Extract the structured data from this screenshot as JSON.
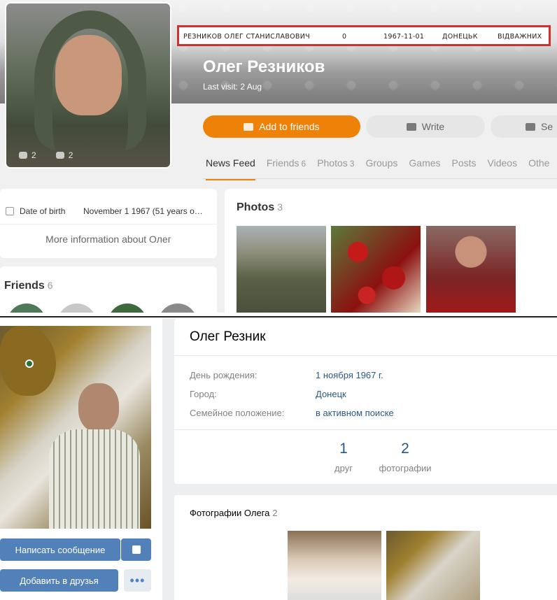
{
  "ok": {
    "avatar_stats": {
      "comments": "2",
      "likes": "2"
    },
    "highlight": {
      "full_name": "РЕЗНИКОВ ОЛЕГ СТАНИСЛАВОВИЧ",
      "number": "0",
      "date": "1967-11-01",
      "city": "ДОНЕЦЬК",
      "note": "ВІДВАЖНИХ"
    },
    "name": "Олег Резников",
    "last_visit": "Last visit: 2 Aug",
    "buttons": {
      "add_friends": "Add to friends",
      "write": "Write",
      "send": "Se"
    },
    "tabs": [
      {
        "label": "News Feed",
        "count": ""
      },
      {
        "label": "Friends",
        "count": "6"
      },
      {
        "label": "Photos",
        "count": "3"
      },
      {
        "label": "Groups",
        "count": ""
      },
      {
        "label": "Games",
        "count": ""
      },
      {
        "label": "Posts",
        "count": ""
      },
      {
        "label": "Videos",
        "count": ""
      },
      {
        "label": "Othe",
        "count": ""
      }
    ],
    "info": {
      "dob_label": "Date of birth",
      "dob_value": "November 1 1967 (51 years o…",
      "more": "More information about Олег"
    },
    "friends": {
      "title": "Friends",
      "count": "6"
    },
    "photos": {
      "title": "Photos",
      "count": "3"
    },
    "colors": {
      "accent": "#ee8208"
    }
  },
  "vk": {
    "buttons": {
      "message": "Написать сообщение",
      "add_friend": "Добавить в друзья",
      "more": "•••"
    },
    "name": "Олег Резник",
    "rows": [
      {
        "label": "День рождения:",
        "value": "1 ноября 1967 г."
      },
      {
        "label": "Город:",
        "value": "Донецк"
      },
      {
        "label": "Семейное положение:",
        "value": "в активном поиске"
      }
    ],
    "counters": [
      {
        "n": "1",
        "label": "друг"
      },
      {
        "n": "2",
        "label": "фотографии"
      }
    ],
    "photos": {
      "title": "Фотографии Олега",
      "count": "2"
    },
    "colors": {
      "accent": "#5181b8",
      "link": "#2a5885"
    }
  }
}
